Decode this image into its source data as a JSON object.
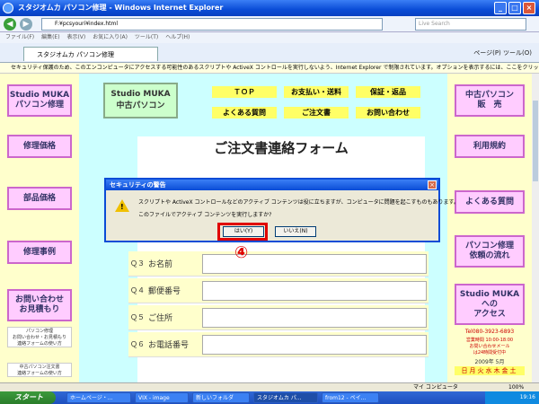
{
  "window": {
    "title": "スタジオムカ パソコン修理 - Windows Internet Explorer",
    "min": "_",
    "max": "□",
    "close": "×"
  },
  "nav": {
    "back": "◀",
    "forward": "▶",
    "address": "F:¥pcsyouri¥index.html",
    "search_placeholder": "Live Search"
  },
  "menu": [
    "ファイル(F)",
    "編集(E)",
    "表示(V)",
    "お気に入り(A)",
    "ツール(T)",
    "ヘルプ(H)"
  ],
  "tab": {
    "label": "スタジオムカ パソコン修理"
  },
  "toolbar": {
    "page": "ページ(P)",
    "tools": "ツール(O)"
  },
  "infobar": "セキュリティ保護のため、このエンコンピュータにアクセスする可能性のあるスクリプトや ActiveX コントロールを実行しないよう、Internet Explorer で制限されています。オプションを表示するには、ここをクリックしてください...",
  "left_menu": [
    "Studio MUKA\nパソコン修理",
    "修理価格",
    "部品価格",
    "修理事例",
    "お問い合わせ\nお見積もり"
  ],
  "left_small": [
    "パソコン修理\nお問い合わせ・お見積もり\n連絡フォームの使い方",
    "中古パソコン注文書\n連絡フォームの使い方"
  ],
  "logo": "Studio MUKA\n中古パソコン",
  "top_nav": [
    "ＴＯＰ",
    "お支払い・送料",
    "保証・返品",
    "よくある質問",
    "ご注文書",
    "お問い合わせ"
  ],
  "right_menu": [
    "中古パソコン\n販　売",
    "利用規約",
    "よくある質問",
    "パソコン修理\n依頼の流れ",
    "Studio MUKA\nへの\nアクセス"
  ],
  "right_info": {
    "tel": "Tel080-3923-6893",
    "hours": "営業時間 10:00-18:00",
    "note": "お問い合わせメール\nは24時間受付中",
    "year": "2009年 5月",
    "days": "日月火水木金土"
  },
  "form": {
    "title": "ご注文書連絡フォーム"
  },
  "rows": [
    {
      "q": "Ｑ３",
      "label": "お名前"
    },
    {
      "q": "Ｑ４",
      "label": "郵便番号"
    },
    {
      "q": "Ｑ５",
      "label": "ご住所"
    },
    {
      "q": "Ｑ６",
      "label": "お電話番号"
    }
  ],
  "dialog": {
    "title": "セキュリティの警告",
    "message1": "スクリプトや ActiveX コントロールなどのアクティブ コンテンツは役に立ちますが、コンピュータに問題を起こすものもあります。",
    "message2": "このファイルでアクティブ コンテンツを実行しますか?",
    "yes": "はい(Y)",
    "no": "いいえ(N)",
    "close": "×"
  },
  "annotation": "④",
  "status": {
    "zone": "マイ コンピュータ",
    "zoom": "100%"
  },
  "taskbar": {
    "start": "スタート",
    "items": [
      "ホームページ・...",
      "VIX - image",
      "新しいフォルダ",
      "スタジオムカ パ...",
      "from12 - ペイ..."
    ],
    "time": "19:16"
  }
}
